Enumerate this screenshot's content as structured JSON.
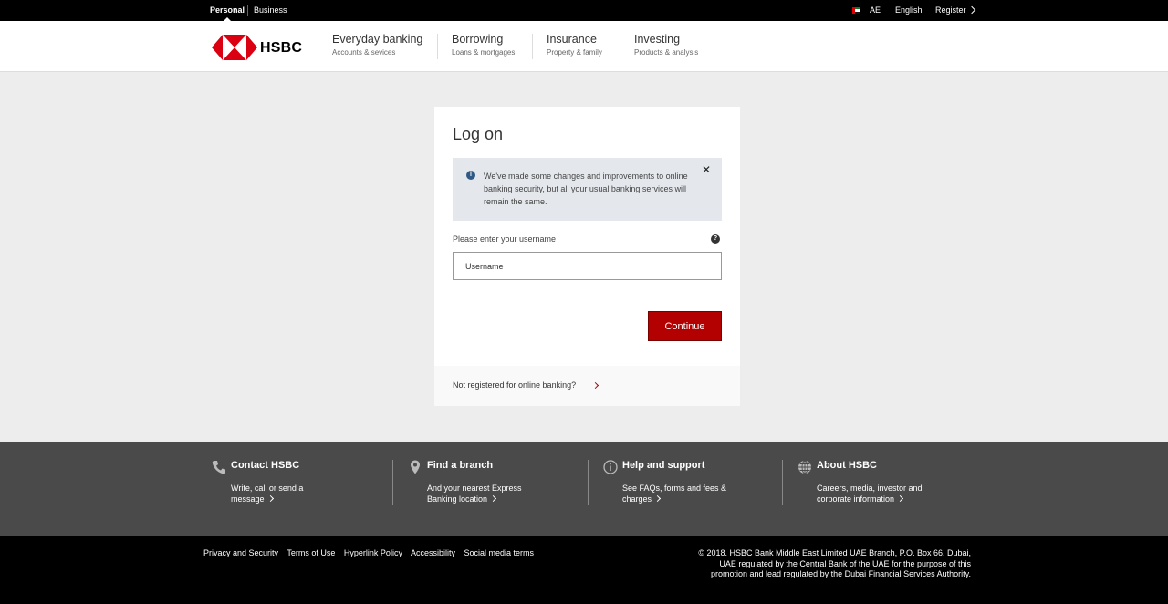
{
  "topbar": {
    "personal": "Personal",
    "business": "Business",
    "country": "AE",
    "language": "English",
    "register": "Register"
  },
  "header": {
    "logo_text": "HSBC",
    "nav": [
      {
        "title": "Everyday banking",
        "subtitle": "Accounts & sevices"
      },
      {
        "title": "Borrowing",
        "subtitle": "Loans & mortgages"
      },
      {
        "title": "Insurance",
        "subtitle": "Property & family"
      },
      {
        "title": "Investing",
        "subtitle": "Products & analysis"
      }
    ]
  },
  "login": {
    "title": "Log on",
    "notice": "We've made some changes and improvements to online banking security, but all your usual banking services will remain the same.",
    "close_glyph": "✕",
    "field_label": "Please enter your username",
    "username_placeholder": "Username",
    "continue_label": "Continue",
    "not_registered": "Not registered for online banking?"
  },
  "footer": {
    "columns": [
      {
        "title": "Contact HSBC",
        "line1": "Write, call or send a",
        "line2": "message",
        "icon": "phone-icon"
      },
      {
        "title": "Find a branch",
        "line1": "And your nearest Express",
        "line2": "Banking location",
        "icon": "location-pin-icon"
      },
      {
        "title": "Help and support",
        "line1": "See FAQs, forms and fees &",
        "line2": "charges",
        "icon": "info-circle-icon"
      },
      {
        "title": "About HSBC",
        "line1": "Careers, media, investor and",
        "line2": "corporate information",
        "icon": "globe-icon"
      }
    ],
    "legal_links": [
      "Privacy and Security",
      "Terms of Use",
      "Hyperlink Policy",
      "Accessibility",
      "Social media terms"
    ],
    "copyright": [
      "© 2018. HSBC Bank Middle East Limited UAE Branch, P.O. Box 66, Dubai,",
      "UAE regulated by the Central Bank of the UAE for the purpose of this",
      "promotion and lead regulated by the Dubai Financial Services Authority."
    ]
  },
  "colors": {
    "brand_red": "#db0011",
    "button_red": "#b30000",
    "footer_grey": "#4a4a4a",
    "notice_bg": "#e4e8ed"
  }
}
